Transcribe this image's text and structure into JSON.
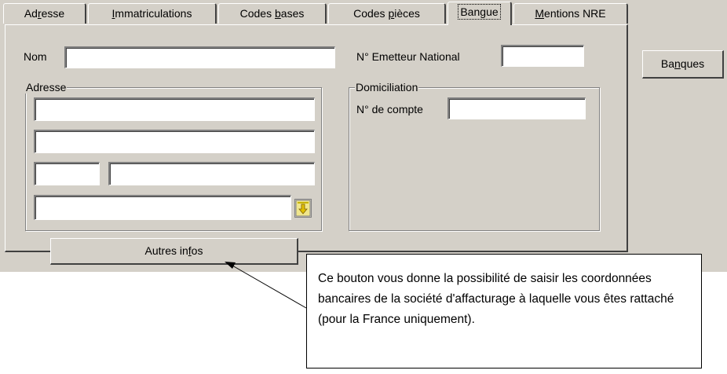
{
  "tabs": [
    {
      "pre": "Ad",
      "key": "r",
      "post": "esse"
    },
    {
      "pre": "",
      "key": "I",
      "post": "mmatriculations"
    },
    {
      "pre": "Codes ",
      "key": "b",
      "post": "ases"
    },
    {
      "pre": "Codes ",
      "key": "p",
      "post": "ièces"
    },
    {
      "pre": "Ban",
      "key": "g",
      "post": "ue"
    },
    {
      "pre": "",
      "key": "M",
      "post": "entions NRE"
    }
  ],
  "form": {
    "nom_label": "Nom",
    "nom_value": "",
    "emetteur_label": "N° Emetteur National",
    "emetteur_value": "",
    "adresse_legend": "Adresse",
    "domiciliation_legend": "Domiciliation",
    "compte_label": "N° de compte",
    "compte_value": ""
  },
  "buttons": {
    "autres_pre": "Autres in",
    "autres_key": "f",
    "autres_post": "os",
    "banques_pre": "Ba",
    "banques_key": "n",
    "banques_post": "ques"
  },
  "callout": {
    "text": "Ce bouton vous donne la possibilité de saisir les coordonnées bancaires de la société d'affacturage à laquelle vous êtes rattaché (pour la France uniquement)."
  },
  "icons": {
    "lookup": "down-arrow-lookup-icon"
  }
}
